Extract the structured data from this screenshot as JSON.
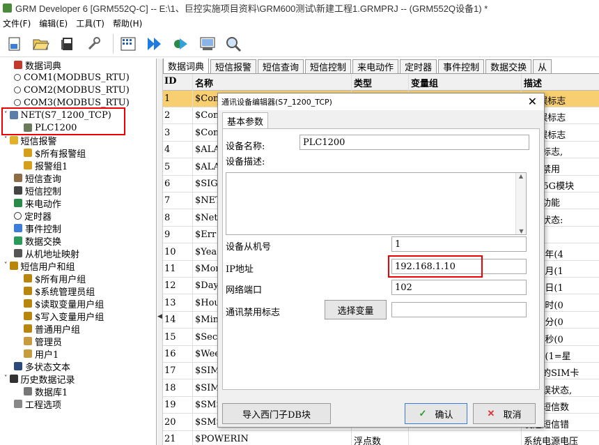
{
  "window": {
    "title": "GRM Developer 6 [GRM552Q-C]  -- E:\\1、巨控实施项目资料\\GRM600测试\\新建工程1.GRMPRJ -- (GRM552Q设备1) *"
  },
  "menu": [
    "文件(F)",
    "编辑(E)",
    "工具(T)",
    "帮助(H)"
  ],
  "toolbar": [
    "new-icon",
    "open-icon",
    "save-icon",
    "wrench-icon",
    "grid-icon",
    "play-icon",
    "run-icon",
    "download-icon",
    "search-icon"
  ],
  "sidebar": {
    "items": [
      {
        "label": "数据词典",
        "indent": 0
      },
      {
        "label": "COM1(MODBUS_RTU)",
        "indent": 1
      },
      {
        "label": "COM2(MODBUS_RTU)",
        "indent": 1
      },
      {
        "label": "COM3(MODBUS_RTU)",
        "indent": 1
      },
      {
        "label": "NET(S7_1200_TCP)",
        "indent": 1
      },
      {
        "label": "PLC1200",
        "indent": 2
      },
      {
        "label": "短信报警",
        "indent": 1
      },
      {
        "label": "$所有报警组",
        "indent": 2
      },
      {
        "label": "报警组1",
        "indent": 2
      },
      {
        "label": "短信查询",
        "indent": 1
      },
      {
        "label": "短信控制",
        "indent": 1
      },
      {
        "label": "来电动作",
        "indent": 1
      },
      {
        "label": "定时器",
        "indent": 1
      },
      {
        "label": "事件控制",
        "indent": 1
      },
      {
        "label": "数据交换",
        "indent": 1
      },
      {
        "label": "从机地址映射",
        "indent": 1
      },
      {
        "label": "短信用户和组",
        "indent": 1
      },
      {
        "label": "$所有用户组",
        "indent": 2
      },
      {
        "label": "$系统管理员组",
        "indent": 2
      },
      {
        "label": "$读取变量用户组",
        "indent": 2
      },
      {
        "label": "$写入变量用户组",
        "indent": 2
      },
      {
        "label": "普通用户组",
        "indent": 2
      },
      {
        "label": "管理员",
        "indent": 2
      },
      {
        "label": "用户1",
        "indent": 2
      },
      {
        "label": "多状态文本",
        "indent": 1
      },
      {
        "label": "历史数据记录",
        "indent": 1
      },
      {
        "label": "数据库1",
        "indent": 2
      },
      {
        "label": "工程选项",
        "indent": 1
      }
    ]
  },
  "tabs": [
    "数据词典",
    "短信报警",
    "短信查询",
    "短信控制",
    "来电动作",
    "定时器",
    "事件控制",
    "数据交换",
    "从"
  ],
  "grid": {
    "headers": [
      "ID",
      "名称",
      "类型",
      "变量组",
      "描述"
    ],
    "rows": [
      {
        "id": "1",
        "name": "$Com",
        "type": "",
        "group": "",
        "desc": "1错误标志"
      },
      {
        "id": "2",
        "name": "$Com",
        "type": "",
        "group": "",
        "desc": "2错误标志"
      },
      {
        "id": "3",
        "name": "$Com",
        "type": "",
        "group": "",
        "desc": "3错误标志"
      },
      {
        "id": "4",
        "name": "$ALA",
        "type": "",
        "group": "",
        "desc": "报警标志,"
      },
      {
        "id": "5",
        "name": "$ALA",
        "type": "",
        "group": "",
        "desc": "报警禁用"
      },
      {
        "id": "6",
        "name": "$SIG",
        "type": "",
        "group": "",
        "desc": "/4G/5G模块"
      },
      {
        "id": "7",
        "name": "$NET",
        "type": "",
        "group": "",
        "desc": "网络功能"
      },
      {
        "id": "8",
        "name": "$Net",
        "type": "",
        "group": "",
        "desc": "连接状态:"
      },
      {
        "id": "9",
        "name": "$Err",
        "type": "",
        "group": "",
        "desc": "代码"
      },
      {
        "id": "10",
        "name": "$Yea",
        "type": "",
        "group": "",
        "desc": "日期:年(4"
      },
      {
        "id": "11",
        "name": "$Mon",
        "type": "",
        "group": "",
        "desc": "日期:月(1"
      },
      {
        "id": "12",
        "name": "$Day",
        "type": "",
        "group": "",
        "desc": "日期:日(1"
      },
      {
        "id": "13",
        "name": "$Hou",
        "type": "",
        "group": "",
        "desc": "时间:时(0"
      },
      {
        "id": "14",
        "name": "$Min",
        "type": "",
        "group": "",
        "desc": "时间:分(0"
      },
      {
        "id": "15",
        "name": "$Sec",
        "type": "",
        "group": "",
        "desc": "时间:秒(0"
      },
      {
        "id": "16",
        "name": "$Wee",
        "type": "",
        "group": "",
        "desc": "星期:(1=星"
      },
      {
        "id": "17",
        "name": "$SIM",
        "type": "",
        "group": "",
        "desc": "插入的SIM卡"
      },
      {
        "id": "18",
        "name": "$SIM",
        "type": "",
        "group": "",
        "desc": "卡错误状态,"
      },
      {
        "id": "19",
        "name": "$SMS",
        "type": "",
        "group": "",
        "desc": "发送短信数"
      },
      {
        "id": "20",
        "name": "$SMS",
        "type": "",
        "group": "",
        "desc": "发送短信错"
      },
      {
        "id": "21",
        "name": "$POWERIN",
        "type": "浮点数",
        "group": "",
        "desc": "系统电源电压"
      }
    ]
  },
  "dialog": {
    "title": "通讯设备编辑器(S7_1200_TCP)",
    "tab": "基本参数",
    "device_name_label": "设备名称:",
    "device_name_value": "PLC1200",
    "device_desc_label": "设备描述:",
    "device_desc_value": "",
    "slave_label": "设备从机号",
    "slave_value": "1",
    "ip_label": "IP地址",
    "ip_value": "192.168.1.10",
    "port_label": "网络端口",
    "port_value": "102",
    "disable_label": "通讯禁用标志",
    "select_var_button": "选择变量",
    "disable_value": "",
    "import_button": "导入西门子DB块",
    "ok_button": "确认",
    "cancel_button": "取消"
  }
}
